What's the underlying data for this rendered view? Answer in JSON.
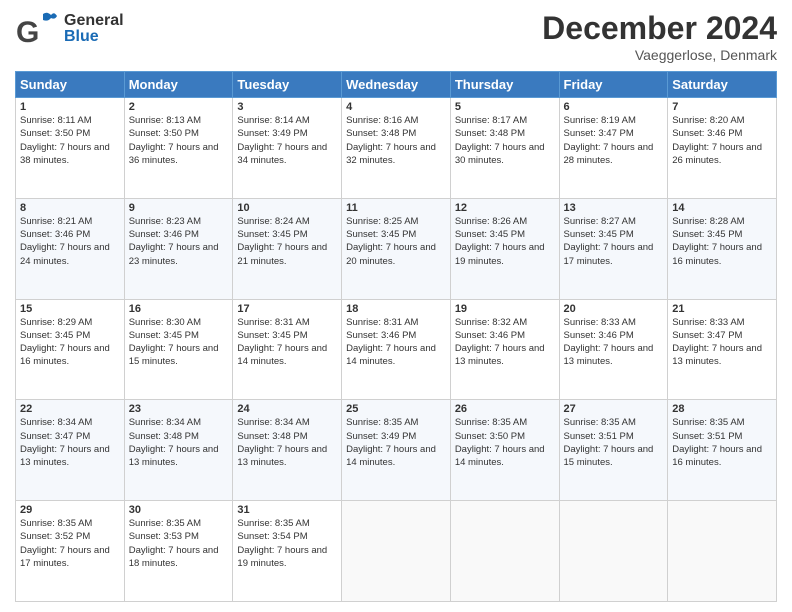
{
  "header": {
    "month_title": "December 2024",
    "location": "Vaeggerlose, Denmark",
    "logo_general": "General",
    "logo_blue": "Blue"
  },
  "weekdays": [
    "Sunday",
    "Monday",
    "Tuesday",
    "Wednesday",
    "Thursday",
    "Friday",
    "Saturday"
  ],
  "weeks": [
    [
      {
        "day": "1",
        "sunrise": "8:11 AM",
        "sunset": "3:50 PM",
        "daylight": "7 hours and 38 minutes."
      },
      {
        "day": "2",
        "sunrise": "8:13 AM",
        "sunset": "3:50 PM",
        "daylight": "7 hours and 36 minutes."
      },
      {
        "day": "3",
        "sunrise": "8:14 AM",
        "sunset": "3:49 PM",
        "daylight": "7 hours and 34 minutes."
      },
      {
        "day": "4",
        "sunrise": "8:16 AM",
        "sunset": "3:48 PM",
        "daylight": "7 hours and 32 minutes."
      },
      {
        "day": "5",
        "sunrise": "8:17 AM",
        "sunset": "3:48 PM",
        "daylight": "7 hours and 30 minutes."
      },
      {
        "day": "6",
        "sunrise": "8:19 AM",
        "sunset": "3:47 PM",
        "daylight": "7 hours and 28 minutes."
      },
      {
        "day": "7",
        "sunrise": "8:20 AM",
        "sunset": "3:46 PM",
        "daylight": "7 hours and 26 minutes."
      }
    ],
    [
      {
        "day": "8",
        "sunrise": "8:21 AM",
        "sunset": "3:46 PM",
        "daylight": "7 hours and 24 minutes."
      },
      {
        "day": "9",
        "sunrise": "8:23 AM",
        "sunset": "3:46 PM",
        "daylight": "7 hours and 23 minutes."
      },
      {
        "day": "10",
        "sunrise": "8:24 AM",
        "sunset": "3:45 PM",
        "daylight": "7 hours and 21 minutes."
      },
      {
        "day": "11",
        "sunrise": "8:25 AM",
        "sunset": "3:45 PM",
        "daylight": "7 hours and 20 minutes."
      },
      {
        "day": "12",
        "sunrise": "8:26 AM",
        "sunset": "3:45 PM",
        "daylight": "7 hours and 19 minutes."
      },
      {
        "day": "13",
        "sunrise": "8:27 AM",
        "sunset": "3:45 PM",
        "daylight": "7 hours and 17 minutes."
      },
      {
        "day": "14",
        "sunrise": "8:28 AM",
        "sunset": "3:45 PM",
        "daylight": "7 hours and 16 minutes."
      }
    ],
    [
      {
        "day": "15",
        "sunrise": "8:29 AM",
        "sunset": "3:45 PM",
        "daylight": "7 hours and 16 minutes."
      },
      {
        "day": "16",
        "sunrise": "8:30 AM",
        "sunset": "3:45 PM",
        "daylight": "7 hours and 15 minutes."
      },
      {
        "day": "17",
        "sunrise": "8:31 AM",
        "sunset": "3:45 PM",
        "daylight": "7 hours and 14 minutes."
      },
      {
        "day": "18",
        "sunrise": "8:31 AM",
        "sunset": "3:46 PM",
        "daylight": "7 hours and 14 minutes."
      },
      {
        "day": "19",
        "sunrise": "8:32 AM",
        "sunset": "3:46 PM",
        "daylight": "7 hours and 13 minutes."
      },
      {
        "day": "20",
        "sunrise": "8:33 AM",
        "sunset": "3:46 PM",
        "daylight": "7 hours and 13 minutes."
      },
      {
        "day": "21",
        "sunrise": "8:33 AM",
        "sunset": "3:47 PM",
        "daylight": "7 hours and 13 minutes."
      }
    ],
    [
      {
        "day": "22",
        "sunrise": "8:34 AM",
        "sunset": "3:47 PM",
        "daylight": "7 hours and 13 minutes."
      },
      {
        "day": "23",
        "sunrise": "8:34 AM",
        "sunset": "3:48 PM",
        "daylight": "7 hours and 13 minutes."
      },
      {
        "day": "24",
        "sunrise": "8:34 AM",
        "sunset": "3:48 PM",
        "daylight": "7 hours and 13 minutes."
      },
      {
        "day": "25",
        "sunrise": "8:35 AM",
        "sunset": "3:49 PM",
        "daylight": "7 hours and 14 minutes."
      },
      {
        "day": "26",
        "sunrise": "8:35 AM",
        "sunset": "3:50 PM",
        "daylight": "7 hours and 14 minutes."
      },
      {
        "day": "27",
        "sunrise": "8:35 AM",
        "sunset": "3:51 PM",
        "daylight": "7 hours and 15 minutes."
      },
      {
        "day": "28",
        "sunrise": "8:35 AM",
        "sunset": "3:51 PM",
        "daylight": "7 hours and 16 minutes."
      }
    ],
    [
      {
        "day": "29",
        "sunrise": "8:35 AM",
        "sunset": "3:52 PM",
        "daylight": "7 hours and 17 minutes."
      },
      {
        "day": "30",
        "sunrise": "8:35 AM",
        "sunset": "3:53 PM",
        "daylight": "7 hours and 18 minutes."
      },
      {
        "day": "31",
        "sunrise": "8:35 AM",
        "sunset": "3:54 PM",
        "daylight": "7 hours and 19 minutes."
      },
      null,
      null,
      null,
      null
    ]
  ],
  "labels": {
    "sunrise": "Sunrise:",
    "sunset": "Sunset:",
    "daylight": "Daylight:"
  }
}
